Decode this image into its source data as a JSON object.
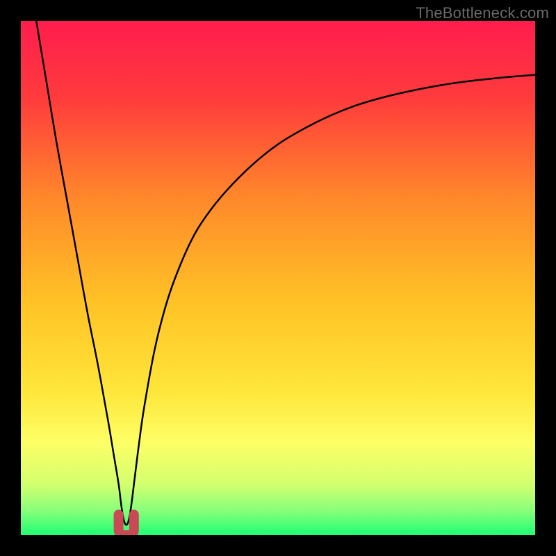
{
  "watermark": "TheBottleneck.com",
  "chart_data": {
    "type": "line",
    "title": "",
    "xlabel": "",
    "ylabel": "",
    "xlim": [
      0,
      100
    ],
    "ylim": [
      0,
      100
    ],
    "grid": false,
    "axes_visible": false,
    "background_gradient": {
      "stops": [
        {
          "offset": 0.0,
          "color": "#ff1d4e"
        },
        {
          "offset": 0.15,
          "color": "#ff3b3c"
        },
        {
          "offset": 0.35,
          "color": "#ff8a2a"
        },
        {
          "offset": 0.55,
          "color": "#ffc326"
        },
        {
          "offset": 0.72,
          "color": "#ffe63a"
        },
        {
          "offset": 0.82,
          "color": "#fdff66"
        },
        {
          "offset": 0.9,
          "color": "#d4ff6e"
        },
        {
          "offset": 0.95,
          "color": "#8cff7a"
        },
        {
          "offset": 1.0,
          "color": "#1fff73"
        }
      ]
    },
    "series": [
      {
        "name": "bottleneck-curve",
        "color": "#000000",
        "stroke_width": 2.5,
        "x": [
          3,
          5,
          7,
          9,
          11,
          13,
          15,
          17,
          18,
          19,
          19.5,
          20,
          20.5,
          21,
          21.5,
          22,
          23,
          24,
          26,
          28,
          30,
          33,
          36,
          40,
          45,
          50,
          55,
          60,
          65,
          70,
          75,
          80,
          85,
          90,
          95,
          100
        ],
        "y": [
          100,
          88,
          76,
          65,
          54,
          43,
          33,
          22,
          16,
          10,
          6,
          3,
          2,
          3,
          6,
          10,
          18,
          25,
          36,
          44,
          50,
          57,
          62,
          67,
          72,
          76,
          79,
          81.5,
          83.5,
          85,
          86.2,
          87.2,
          88,
          88.6,
          89.1,
          89.5
        ]
      }
    ],
    "markers": [
      {
        "name": "notch-marker",
        "shape": "u",
        "color": "#c94a55",
        "stroke_width": 14,
        "x_range": [
          19,
          22
        ],
        "y_base": 1.5,
        "y_depth": 0.0
      }
    ]
  }
}
